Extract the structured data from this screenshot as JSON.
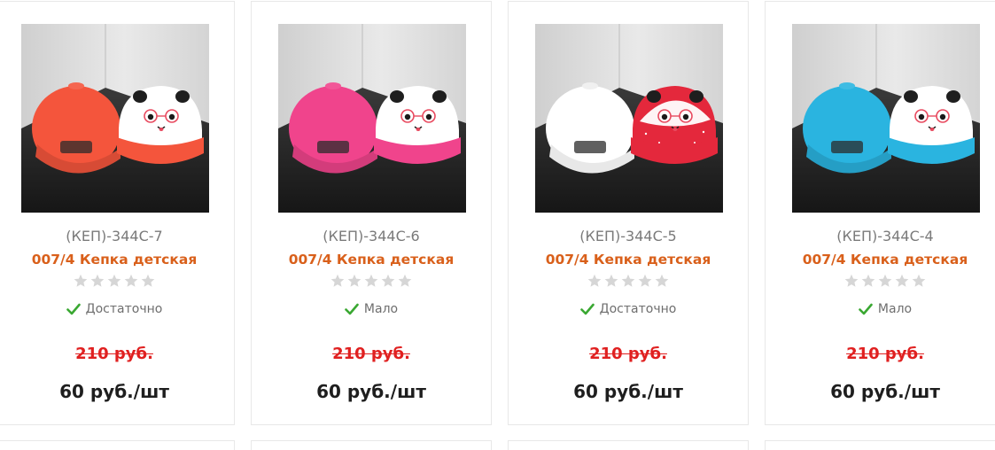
{
  "products": [
    {
      "sku": "(КЕП)-344С-7",
      "name": "007/4 Кепка детская",
      "rating": 0,
      "stock": "Достаточно",
      "old_price": "210 руб.",
      "price": "60 руб./шт",
      "cap_color": "#f4553c",
      "accent_color": "#ffffff",
      "image_icon": "kids-cap-pair-photo"
    },
    {
      "sku": "(КЕП)-344С-6",
      "name": "007/4 Кепка детская",
      "rating": 0,
      "stock": "Мало",
      "old_price": "210 руб.",
      "price": "60 руб./шт",
      "cap_color": "#f0448c",
      "accent_color": "#ffffff",
      "image_icon": "kids-cap-pair-photo"
    },
    {
      "sku": "(КЕП)-344С-5",
      "name": "007/4 Кепка детская",
      "rating": 0,
      "stock": "Достаточно",
      "old_price": "210 руб.",
      "price": "60 руб./шт",
      "cap_color": "#ffffff",
      "accent_color": "#e4283c",
      "image_icon": "kids-cap-pair-photo"
    },
    {
      "sku": "(КЕП)-344С-4",
      "name": "007/4 Кепка детская",
      "rating": 0,
      "stock": "Мало",
      "old_price": "210 руб.",
      "price": "60 руб./шт",
      "cap_color": "#2ab4e0",
      "accent_color": "#ffffff",
      "image_icon": "kids-cap-pair-photo"
    }
  ],
  "colors": {
    "name": "#d9601b",
    "old_price": "#e02020",
    "price": "#1e1e1e",
    "stock_check": "#3aa832",
    "star_empty": "#d6d6d6"
  }
}
